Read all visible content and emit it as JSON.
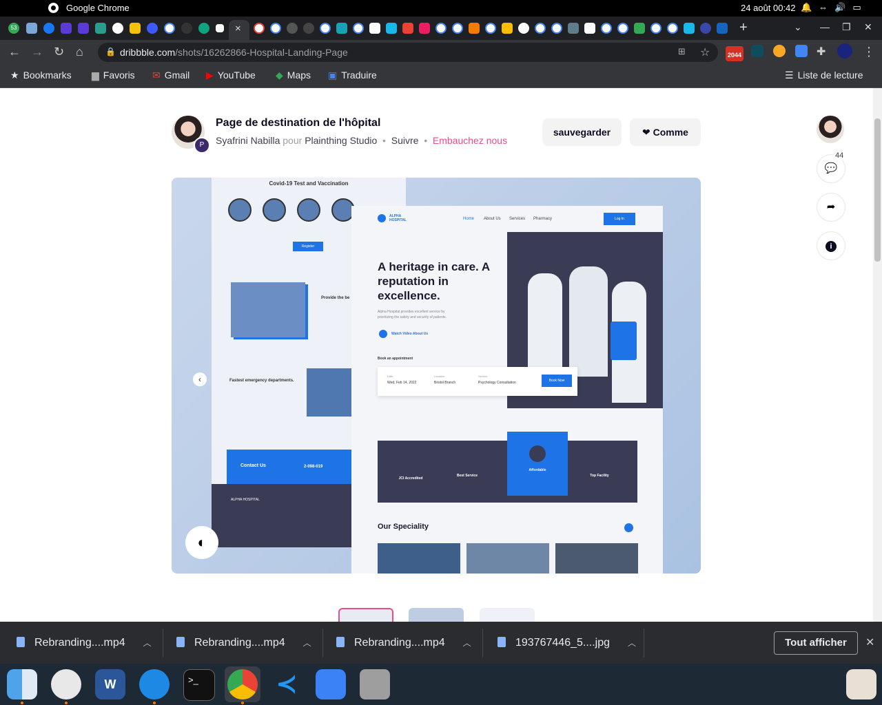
{
  "menubar": {
    "app_name": "Google Chrome",
    "datetime": "24 août  00:42"
  },
  "tabs": {
    "first_badge": "53",
    "close_glyph": "×"
  },
  "address_bar": {
    "domain": "dribbble.com",
    "path": "/shots/16262866-Hospital-Landing-Page"
  },
  "extensions": {
    "badge": "2044"
  },
  "bookmarks": {
    "items": [
      "Bookmarks",
      "Favoris",
      "Gmail",
      "YouTube",
      "Maps",
      "Traduire"
    ],
    "reading_list": "Liste de lecture"
  },
  "shot": {
    "title": "Page de destination de l'hôpital",
    "author": "Syafrini Nabilla",
    "for_word": "pour",
    "team": "Plainthing Studio",
    "follow": "Suivre",
    "hire": "Embauchez nous",
    "save_label": "sauvegarder",
    "like_label": "Comme",
    "comment_count": "44"
  },
  "mockup": {
    "back_title": "Covid-19 Test and Vaccination",
    "register": "Register",
    "provide": "Provide the be",
    "emergency": "Fastest emergency departments.",
    "contact": "Contact Us",
    "phone": "2-098-019",
    "logo": "ALPHA HOSPITAL",
    "nav": [
      "Home",
      "About Us",
      "Services",
      "Pharmacy"
    ],
    "login": "Log In",
    "headline": "A heritage in care. A reputation in excellence.",
    "subtext": "Alpha Hospital provides excellent service by prioritizing the safety and security of patients.",
    "watch": "Watch Video About Us",
    "appointment": "Book an appointment",
    "date_label": "Date",
    "date_value": "Wed, Feb 14, 2022",
    "location_label": "Location",
    "location_value": "Bristol Branch",
    "service_label": "Service",
    "service_value": "Psychology Consultation",
    "book_now": "Book Now",
    "features": [
      "JCI Accredited",
      "Best Service",
      "Affordable",
      "Top Facility"
    ],
    "speciality": "Our Speciality"
  },
  "downloads": {
    "items": [
      "Rebranding....mp4",
      "Rebranding....mp4",
      "Rebranding....mp4",
      "193767446_5....jpg"
    ],
    "show_all": "Tout afficher"
  },
  "colors": {
    "pink": "#ea4c89",
    "hospital_blue": "#1e74e6",
    "hospital_dark": "#3a3b55"
  }
}
